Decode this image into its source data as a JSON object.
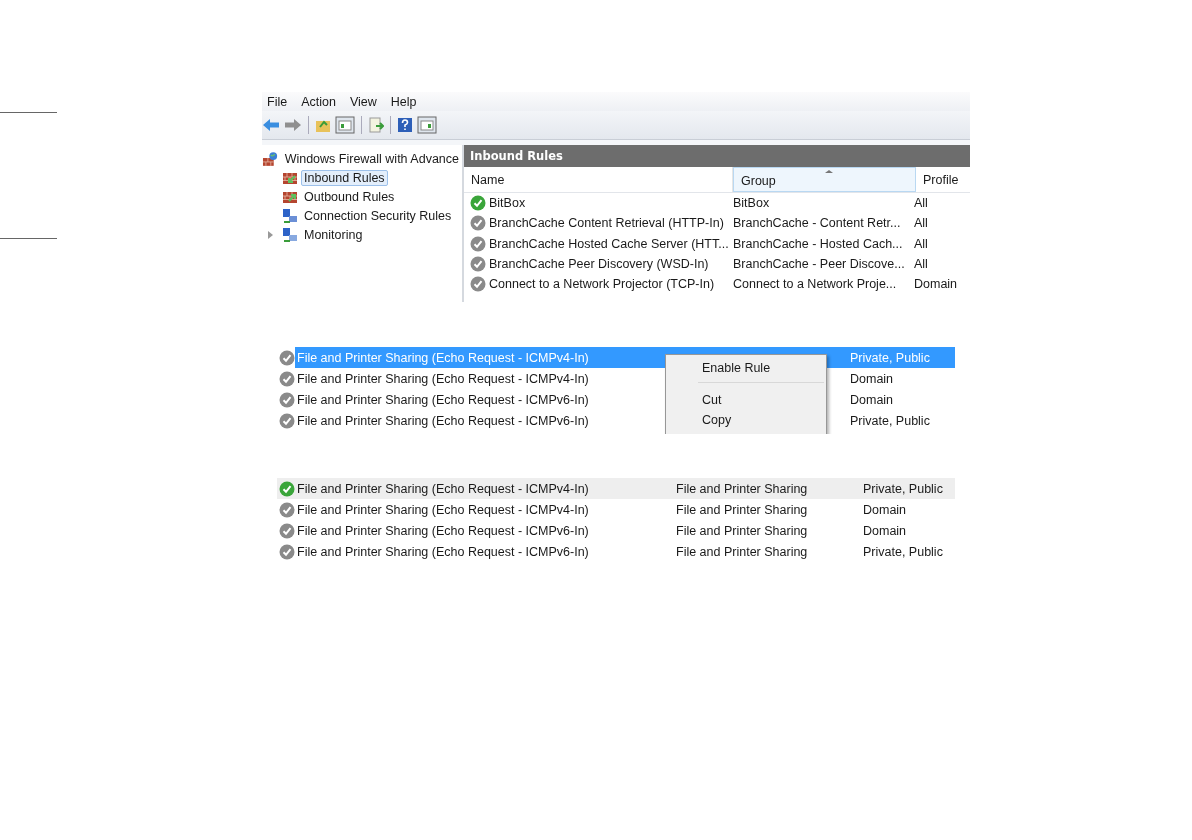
{
  "console": {
    "menu": [
      "File",
      "Action",
      "View",
      "Help"
    ],
    "tree": {
      "label": "Windows Firewall with Advance",
      "children": [
        {
          "label": "Inbound Rules",
          "kind": "inbound",
          "selected": true,
          "expandable": false
        },
        {
          "label": "Outbound Rules",
          "kind": "outbound",
          "selected": false,
          "expandable": false
        },
        {
          "label": "Connection Security Rules",
          "kind": "security",
          "selected": false,
          "expandable": false
        },
        {
          "label": "Monitoring",
          "kind": "monitor",
          "selected": false,
          "expandable": true
        }
      ]
    },
    "pane_title": "Inbound Rules",
    "columns": [
      {
        "label": "Name",
        "sorted": false
      },
      {
        "label": "Group",
        "sorted": true
      },
      {
        "label": "Profile",
        "sorted": false
      }
    ],
    "rows": [
      {
        "name": "BitBox",
        "group": "BitBox",
        "profile": "All",
        "enabled": true
      },
      {
        "name": "BranchCache Content Retrieval (HTTP-In)",
        "group": "BranchCache - Content Retr...",
        "profile": "All",
        "enabled": false
      },
      {
        "name": "BranchCache Hosted Cache Server (HTT...",
        "group": "BranchCache - Hosted Cach...",
        "profile": "All",
        "enabled": false
      },
      {
        "name": "BranchCache Peer Discovery (WSD-In)",
        "group": "BranchCache - Peer Discove...",
        "profile": "All",
        "enabled": false
      },
      {
        "name": "Connect to a Network Projector (TCP-In)",
        "group": "Connect to a Network Proje...",
        "profile": "Domain",
        "enabled": false
      }
    ]
  },
  "context_view": {
    "rows": [
      {
        "name": "File and Printer Sharing (Echo Request - ICMPv4-In)",
        "profile": "Private, Public",
        "enabled": false,
        "selected": true
      },
      {
        "name": "File and Printer Sharing (Echo Request - ICMPv4-In)",
        "profile": "Domain",
        "enabled": false,
        "selected": false
      },
      {
        "name": "File and Printer Sharing (Echo Request - ICMPv6-In)",
        "profile": "Domain",
        "enabled": false,
        "selected": false
      },
      {
        "name": "File and Printer Sharing (Echo Request - ICMPv6-In)",
        "profile": "Private, Public",
        "enabled": false,
        "selected": false
      }
    ],
    "context_menu": [
      {
        "kind": "item",
        "label": "Enable Rule"
      },
      {
        "kind": "separator"
      },
      {
        "kind": "item",
        "label": "Cut"
      },
      {
        "kind": "item",
        "label": "Copy"
      }
    ]
  },
  "result_view": {
    "rows": [
      {
        "name": "File and Printer Sharing (Echo Request - ICMPv4-In)",
        "group": "File and Printer Sharing",
        "profile": "Private, Public",
        "enabled": true,
        "hovered": true
      },
      {
        "name": "File and Printer Sharing (Echo Request - ICMPv4-In)",
        "group": "File and Printer Sharing",
        "profile": "Domain",
        "enabled": false,
        "hovered": false
      },
      {
        "name": "File and Printer Sharing (Echo Request - ICMPv6-In)",
        "group": "File and Printer Sharing",
        "profile": "Domain",
        "enabled": false,
        "hovered": false
      },
      {
        "name": "File and Printer Sharing (Echo Request - ICMPv6-In)",
        "group": "File and Printer Sharing",
        "profile": "Private, Public",
        "enabled": false,
        "hovered": false
      }
    ]
  }
}
